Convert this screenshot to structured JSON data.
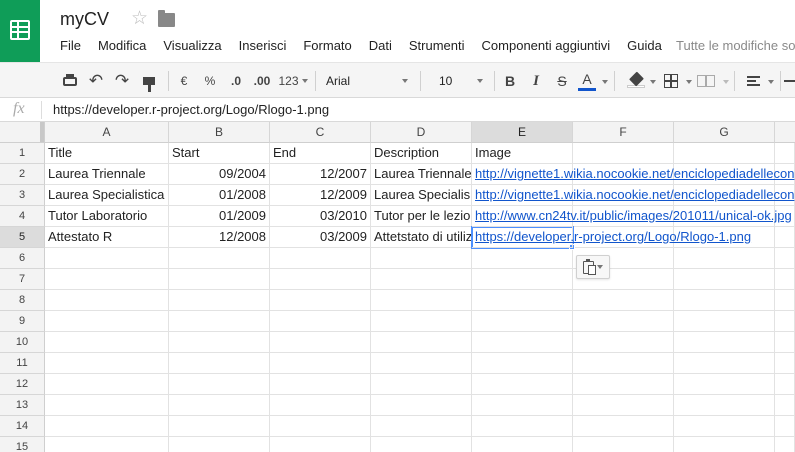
{
  "app": {
    "doc_title": "myCV",
    "save_status": "Tutte le modifiche so"
  },
  "menu": [
    "File",
    "Modifica",
    "Visualizza",
    "Inserisci",
    "Formato",
    "Dati",
    "Strumenti",
    "Componenti aggiuntivi",
    "Guida"
  ],
  "toolbar": {
    "currency_label": "€",
    "percent_label": "%",
    "decrease_decimals_label": ".0",
    "increase_decimals_label": ".00",
    "more_formats_label": "123",
    "font_family": "Arial",
    "font_size": "10",
    "bold_label": "B",
    "italic_label": "I",
    "strike_label": "S",
    "text_color_label": "A",
    "text_color": "#1155cc"
  },
  "formula_bar": {
    "fx_label": "fx",
    "value": "https://developer.r-project.org/Logo/Rlogo-1.png"
  },
  "sheet": {
    "columns": [
      "A",
      "B",
      "C",
      "D",
      "E",
      "F",
      "G"
    ],
    "row_numbers": [
      "1",
      "2",
      "3",
      "4",
      "5",
      "6",
      "7",
      "8",
      "9",
      "10",
      "11",
      "12",
      "13",
      "14",
      "15"
    ],
    "active_column": "E",
    "active_row": "5",
    "rows": [
      [
        "Title",
        "Start",
        "End",
        "Description",
        "Image",
        "",
        ""
      ],
      [
        "Laurea Triennale",
        "09/2004",
        "12/2007",
        "Laurea Triennale",
        "http://vignette1.wikia.nocookie.net/enciclopediadellecon",
        "",
        ""
      ],
      [
        "Laurea Specialistica",
        "01/2008",
        "12/2009",
        "Laurea Specialis",
        "http://vignette1.wikia.nocookie.net/enciclopediadellecon",
        "",
        ""
      ],
      [
        "Tutor Laboratorio",
        "01/2009",
        "03/2010",
        "Tutor per le lezio",
        "http://www.cn24tv.it/public/images/201011/unical-ok.jpg",
        "",
        ""
      ],
      [
        "Attestato R",
        "12/2008",
        "03/2009",
        "Attetstato di utiliz",
        "https://developer.r-project.org/Logo/Rlogo-1.png",
        "",
        ""
      ]
    ]
  }
}
